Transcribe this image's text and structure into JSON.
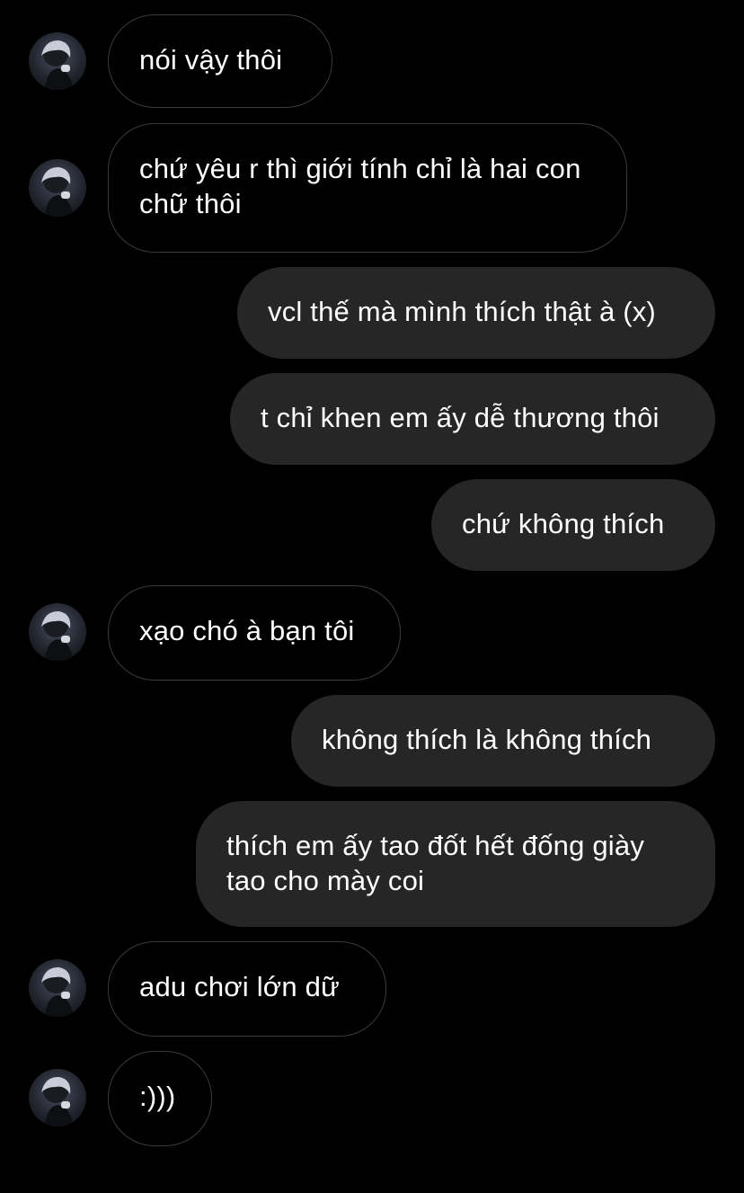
{
  "messages": [
    {
      "side": "received",
      "text": "nói vậy thôi"
    },
    {
      "side": "received",
      "text": "chứ yêu r thì giới tính chỉ là hai con chữ thôi"
    },
    {
      "side": "sent",
      "text": "vcl thế mà mình thích thật à (x)"
    },
    {
      "side": "sent",
      "text": "t chỉ khen em ấy dễ thương thôi"
    },
    {
      "side": "sent",
      "text": "chứ không thích"
    },
    {
      "side": "received",
      "text": "xạo chó à bạn tôi"
    },
    {
      "side": "sent",
      "text": "không thích là không thích"
    },
    {
      "side": "sent",
      "text": "thích em ấy tao đốt hết đống giày tao cho mày coi"
    },
    {
      "side": "received",
      "text": "adu chơi lớn dữ"
    },
    {
      "side": "received",
      "text": ":)))"
    }
  ],
  "colors": {
    "background": "#000000",
    "sent_bubble": "#262626",
    "received_border": "#3a3a3c",
    "text": "#ffffff"
  },
  "avatar_icon": "profile-photo-icon"
}
